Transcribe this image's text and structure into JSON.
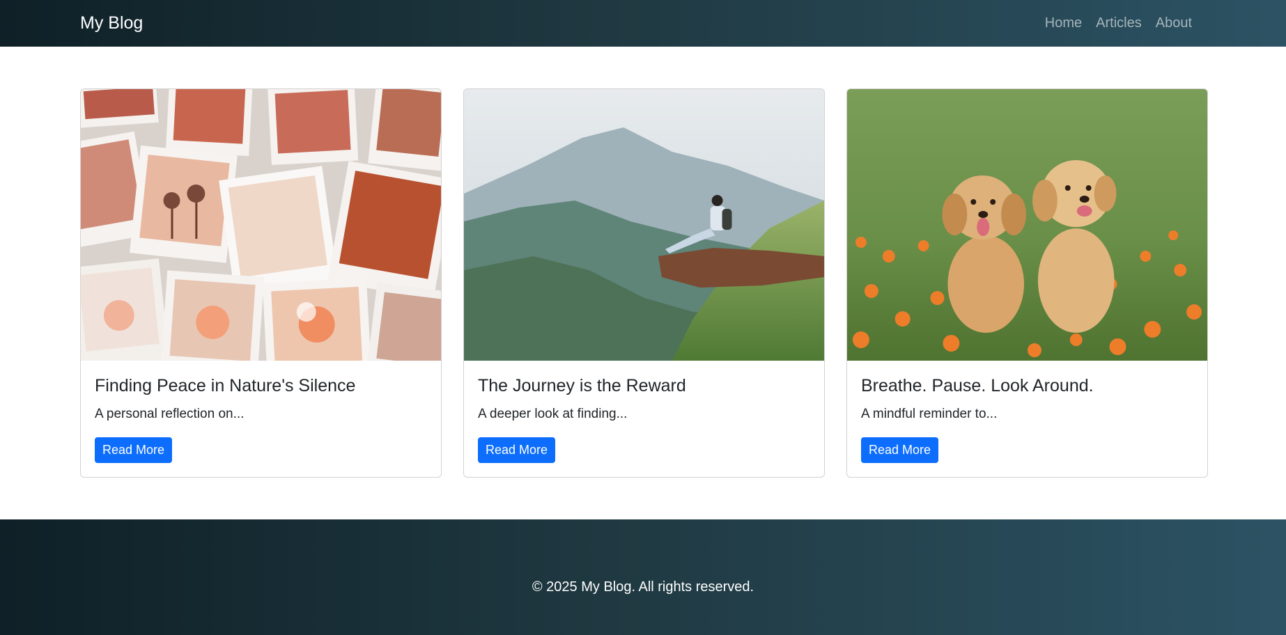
{
  "navbar": {
    "brand": "My Blog",
    "links": [
      "Home",
      "Articles",
      "About"
    ]
  },
  "cards": [
    {
      "title": "Finding Peace in Nature's Silence",
      "text": "A personal reflection on...",
      "button_label": "Read More",
      "image": "polaroid-collage-photo"
    },
    {
      "title": "The Journey is the Reward",
      "text": "A deeper look at finding...",
      "button_label": "Read More",
      "image": "hiker-on-mountain-photo"
    },
    {
      "title": "Breathe. Pause. Look Around.",
      "text": "A mindful reminder to...",
      "button_label": "Read More",
      "image": "golden-puppies-photo"
    }
  ],
  "footer": {
    "copyright": "© 2025 My Blog. All rights reserved."
  },
  "colors": {
    "header_gradient": [
      "#0f2027",
      "#203a43",
      "#2c5364"
    ],
    "button": "#0d6efd"
  }
}
